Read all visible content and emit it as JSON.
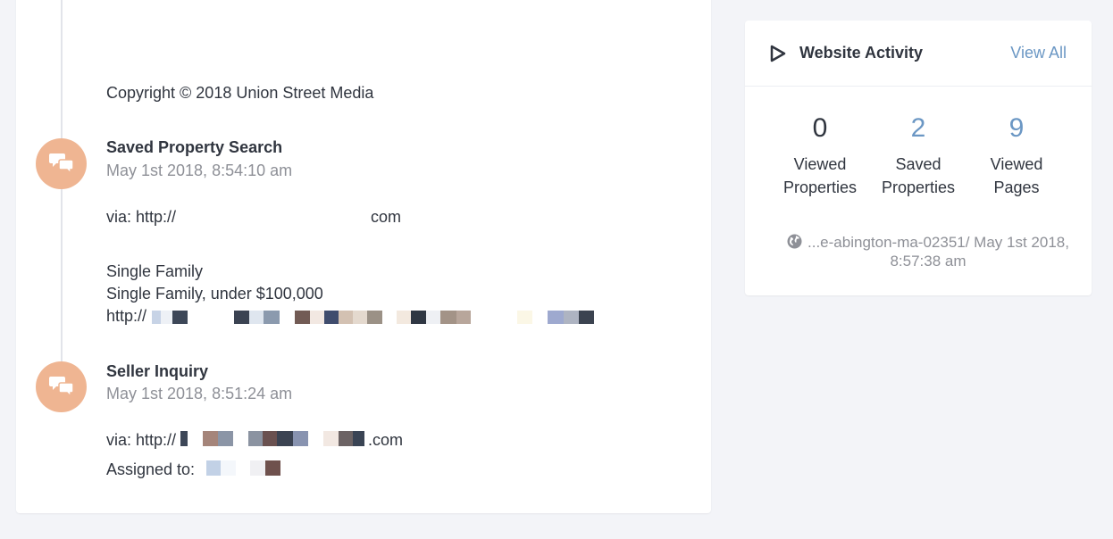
{
  "footer": {
    "copyright": "Copyright © 2018 Union Street Media"
  },
  "timeline": [
    {
      "title": "Saved Property Search",
      "timestamp": "May 1st 2018, 8:54:10 am",
      "via_prefix": "via: http://",
      "via_suffix": "com",
      "lines": [
        "Single Family",
        "Single Family, under $100,000"
      ],
      "link_prefix": "http://"
    },
    {
      "title": "Seller Inquiry",
      "timestamp": "May 1st 2018, 8:51:24 am",
      "via_prefix": "via: http://",
      "via_suffix": ".com",
      "assigned_label": "Assigned to:"
    }
  ],
  "website_activity": {
    "title": "Website Activity",
    "view_all": "View All",
    "stats": [
      {
        "value": "0",
        "label": "Viewed Properties",
        "color": "#30353f"
      },
      {
        "value": "2",
        "label": "Saved Properties",
        "color": "#6b97c4"
      },
      {
        "value": "9",
        "label": "Viewed Pages",
        "color": "#6b97c4"
      }
    ],
    "last_visit": "...e-abington-ma-02351/ May 1st 2018, 8:57:38 am"
  },
  "colors": {
    "avatar": "#efb592",
    "accent": "#6b97c4",
    "text": "#30353f",
    "muted": "#8e9097"
  },
  "icons": {
    "avatar_icon": "chat-bubbles-icon",
    "activity_icon": "play-icon",
    "visit_icon": "globe-icon"
  }
}
